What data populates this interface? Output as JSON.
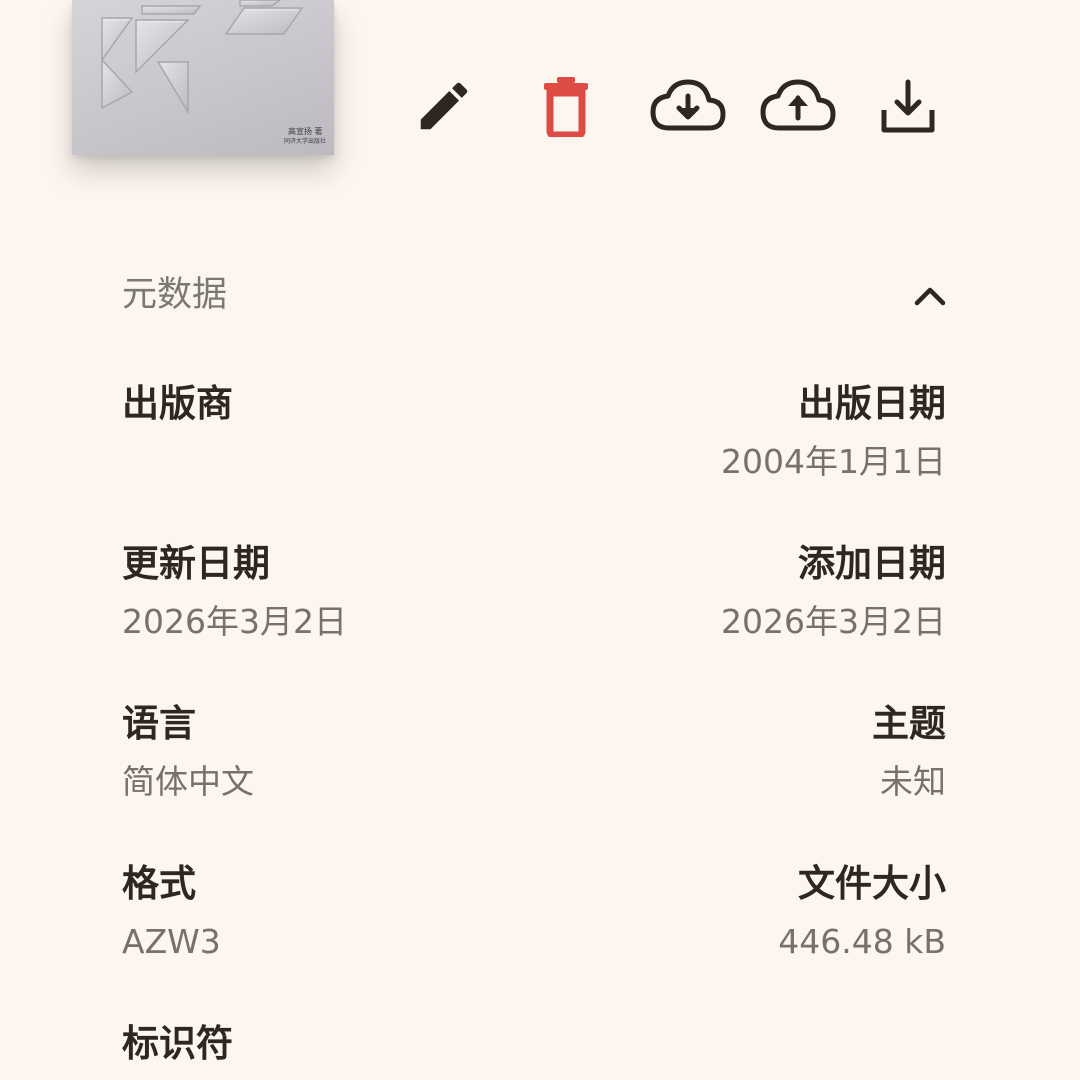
{
  "cover": {
    "author": "高宣扬 著",
    "publisher": "同济大学出版社"
  },
  "actions": {
    "edit": "pencil-icon",
    "delete": "trash-icon",
    "cloud_download": "cloud-download-icon",
    "cloud_upload": "cloud-upload-icon",
    "download": "download-icon"
  },
  "colors": {
    "background": "#fdf6ef",
    "text_primary": "#2f2622",
    "text_secondary": "#76716e",
    "danger": "#de4b45"
  },
  "metadata": {
    "title": "元数据",
    "fields": {
      "publisher": {
        "label": "出版商",
        "value": ""
      },
      "publish_date": {
        "label": "出版日期",
        "value": "2004年1月1日"
      },
      "updated_date": {
        "label": "更新日期",
        "value": "2026年3月2日"
      },
      "added_date": {
        "label": "添加日期",
        "value": "2026年3月2日"
      },
      "language": {
        "label": "语言",
        "value": "简体中文"
      },
      "subject": {
        "label": "主题",
        "value": "未知"
      },
      "format": {
        "label": "格式",
        "value": "AZW3"
      },
      "file_size": {
        "label": "文件大小",
        "value": "446.48 kB"
      },
      "identifier": {
        "label": "标识符",
        "value": ""
      }
    }
  }
}
